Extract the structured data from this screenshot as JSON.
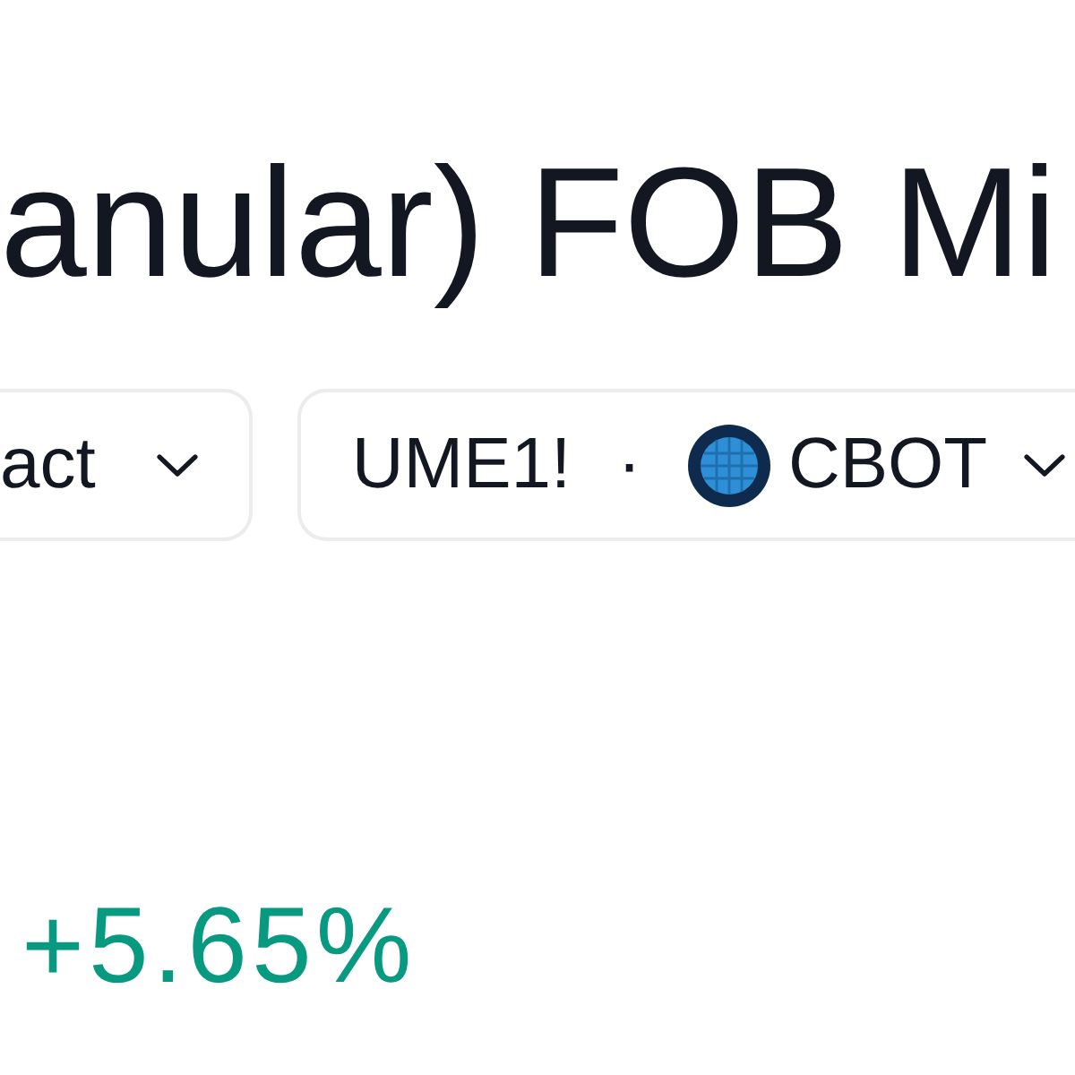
{
  "title": "anular) FOB Mi",
  "selectors": [
    {
      "kind": "contract",
      "label": "act"
    },
    {
      "kind": "symbol",
      "symbol": "UME1!",
      "separator": "·",
      "exchange": "CBOT"
    }
  ],
  "change": {
    "value": "+5.65%",
    "rising": true
  }
}
